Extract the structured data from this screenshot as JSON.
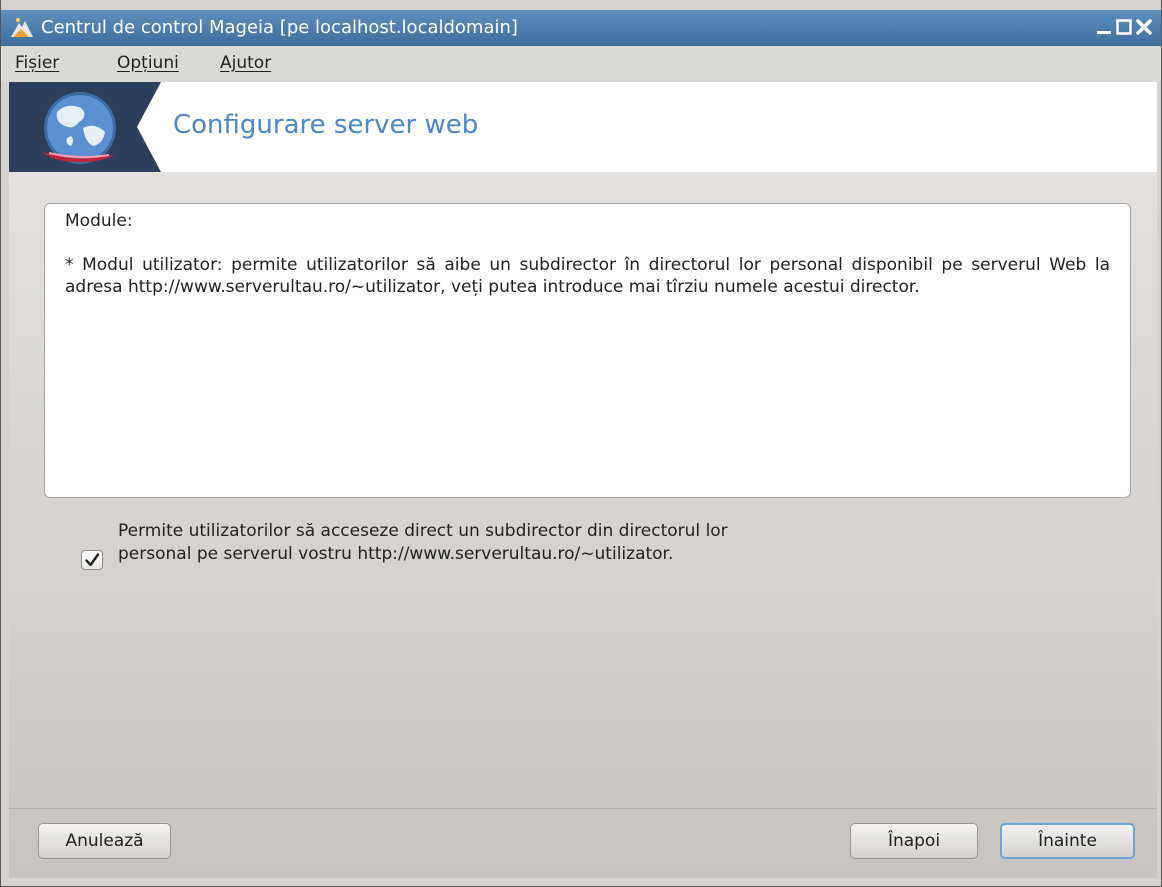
{
  "window": {
    "title": "Centrul de control Mageia  [pe localhost.localdomain]"
  },
  "menubar": {
    "items": [
      "Fișier",
      "Opțiuni",
      "Ajutor"
    ]
  },
  "banner": {
    "title": "Configurare server web",
    "icon": "web-server-globe-icon"
  },
  "description": {
    "heading": "Module:",
    "body": "* Modul utilizator: permite utilizatorilor să aibe un subdirector în directorul lor personal disponibil pe serverul Web la adresa http://www.serverultau.ro/~utilizator, veți putea introduce mai tîrziu numele acestui director."
  },
  "option": {
    "label": "Permite utilizatorilor să acceseze direct un subdirector din directorul lor personal pe serverul vostru http://www.serverultau.ro/~utilizator.",
    "checked": true
  },
  "buttons": {
    "cancel": "Anulează",
    "back": "Înapoi",
    "next": "Înainte"
  },
  "colors": {
    "titlebar": "#4a7aab",
    "accent": "#4d87c7",
    "focus_border": "#6fa4d8"
  }
}
